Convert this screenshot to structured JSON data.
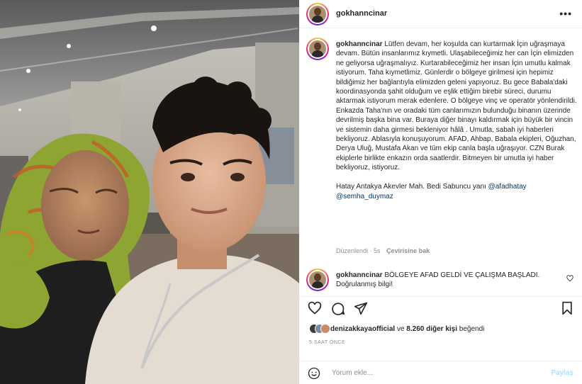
{
  "post": {
    "username": "gokhanncinar",
    "more_label": "•••",
    "caption_username": "gokhanncinar",
    "caption_text": " Lütfen devam, her koşulda can kurtarmak İçin uğraşmaya devam. Bütün insanlarımız kıymetli. Ulaşabileceğimiz her can İçin elimizden ne geliyorsa uğraşmalıyız. Kurtarabileceğimiz her insan İçin umutlu kalmak istiyorum. Taha kıymetlimiz. Günlerdir o bölgeye girilmesi için hepimiz bildiğimiz her bağlantıyla elimizden geleni yapıyoruz. Bu gece Babala'daki koordinasyonda şahit olduğum ve eşlik ettiğim birebir süreci, durumu aktarmak istiyorum merak edenlere. O bölgeye vinç ve operatör yönlendirildi. Enkazda Taha'nın ve oradaki tüm canlarımızın bulunduğu binanın üzerinde devrilmiş başka bina var. Buraya diğer binayı kaldırmak için büyük bir vincin ve sistemin daha girmesi bekleniyor hâlâ . Umutla, sabah iyi haberleri bekliyoruz. Ablasıyla konuşuyorum. AFAD, Ahbap, Babala ekipleri, Oğuzhan, Derya Uluğ, Mustafa Akan ve tüm ekip canla başla uğraşıyor. CZN Burak ekiplerle birlikte enkazın orda saatlerdir. Bitmeyen bir umutla iyi haber bekliyoruz, istiyoruz.\n\nHatay Antakya Akevler Mah. Bedi Sabuncu yanı ",
    "mention1": "@afadhatay",
    "mention2": "@semha_duymaz",
    "edited_label": "Düzenlendi · 5s",
    "see_translation": "Çevirisine bak"
  },
  "comment": {
    "username": "gokhanncinar",
    "text": " BÖLGEYE AFAD GELDİ VE ÇALIŞMA BAŞLADI. Doğrulanmış bilgi!"
  },
  "likes": {
    "liker": "denizakkaya",
    "liker_rest": "official",
    "connector": " ve ",
    "others": "8.260 diğer kişi",
    "suffix": " beğendi"
  },
  "time_label": "5 SAAT ÖNCE",
  "add_comment": {
    "placeholder": "Yorum ekle...",
    "post_label": "Paylaş"
  },
  "icons": {
    "header_more": "more-dots-icon",
    "like": "heart-icon",
    "comment": "comment-bubble-icon",
    "share": "paper-plane-icon",
    "save": "bookmark-icon",
    "emoji": "emoji-smile-icon",
    "comment_like": "small-heart-icon"
  },
  "colors": {
    "link": "#00376b",
    "muted": "#8e8e8e",
    "post_button_disabled": "#b2dffc",
    "text": "#262626"
  }
}
